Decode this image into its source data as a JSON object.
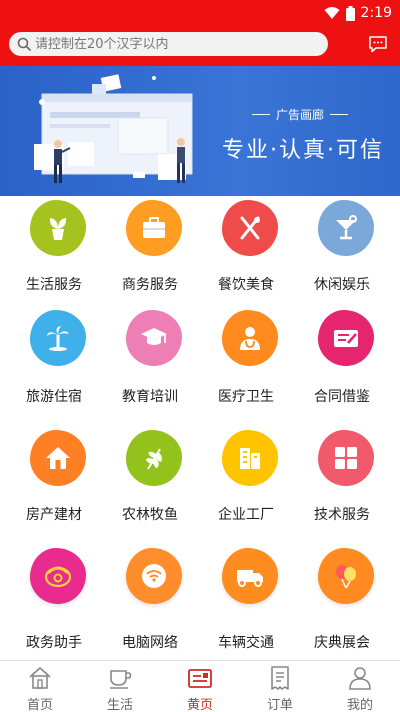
{
  "status_bar": {
    "time": "2:19"
  },
  "search": {
    "placeholder": "请控制在20个汉字以内"
  },
  "banner": {
    "small_text": "广告画廊",
    "big_text": "专业·认真·可信"
  },
  "categories": [
    {
      "label": "生活服务",
      "color": "#a6c21e",
      "icon": "plant-icon"
    },
    {
      "label": "商务服务",
      "color": "#ff9c22",
      "icon": "briefcase-icon"
    },
    {
      "label": "餐饮美食",
      "color": "#ef4b4b",
      "icon": "fork-knife-icon"
    },
    {
      "label": "休闲娱乐",
      "color": "#7aa9d9",
      "icon": "cocktail-icon"
    },
    {
      "label": "旅游住宿",
      "color": "#3fb0ea",
      "icon": "palm-tree-icon"
    },
    {
      "label": "教育培训",
      "color": "#ee7fb6",
      "icon": "graduation-cap-icon"
    },
    {
      "label": "医疗卫生",
      "color": "#ff8a1e",
      "icon": "doctor-icon"
    },
    {
      "label": "合同借鉴",
      "color": "#e5266f",
      "icon": "contract-icon"
    },
    {
      "label": "房产建材",
      "color": "#ff7f24",
      "icon": "house-icon"
    },
    {
      "label": "农林牧鱼",
      "color": "#93c21d",
      "icon": "wheat-icon"
    },
    {
      "label": "企业工厂",
      "color": "#ffc400",
      "icon": "building-icon"
    },
    {
      "label": "技术服务",
      "color": "#f05a6b",
      "icon": "grid-icon"
    },
    {
      "label": "政务助手",
      "color": "#e92b8f",
      "icon": "telephone-icon"
    },
    {
      "label": "电脑网络",
      "color": "#ff8d2c",
      "icon": "wifi-icon"
    },
    {
      "label": "车辆交通",
      "color": "#ff8c1e",
      "icon": "truck-icon"
    },
    {
      "label": "庆典展会",
      "color": "#ff8a22",
      "icon": "balloon-icon"
    }
  ],
  "bottom_nav": {
    "items": [
      {
        "label": "首页",
        "icon": "home-icon"
      },
      {
        "label": "生活",
        "icon": "cup-icon"
      },
      {
        "label": "黄页",
        "icon": "yellow-pages-icon"
      },
      {
        "label": "订单",
        "icon": "receipt-icon"
      },
      {
        "label": "我的",
        "icon": "user-icon"
      }
    ],
    "active_index": 2,
    "active_color": "#d12a2a",
    "inactive_color": "#666666"
  },
  "colors": {
    "header_red": "#ee1111",
    "banner_blue": "#2a62c8"
  }
}
